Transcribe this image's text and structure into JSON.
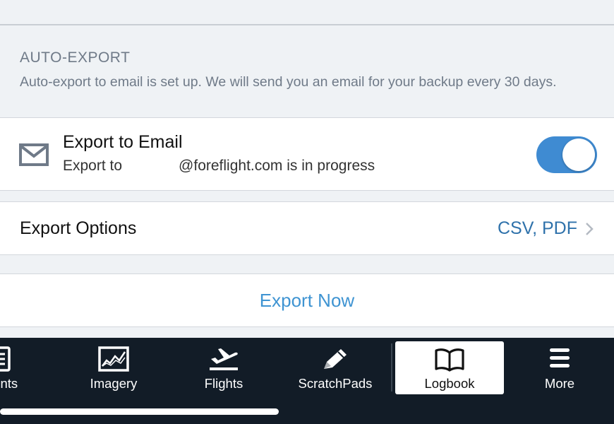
{
  "section": {
    "header": "AUTO-EXPORT",
    "description": "Auto-export to email is set up. We will send you an email for your backup every 30 days."
  },
  "export_email": {
    "title": "Export to Email",
    "subtitle_prefix": "Export to",
    "subtitle_suffix": "@foreflight.com is in progress",
    "toggle_on": true
  },
  "export_options": {
    "label": "Export Options",
    "value": "CSV, PDF"
  },
  "export_now": {
    "label": "Export Now"
  },
  "tabbar": {
    "tabs": [
      {
        "label": "ments",
        "icon": "documents-icon"
      },
      {
        "label": "Imagery",
        "icon": "imagery-icon"
      },
      {
        "label": "Flights",
        "icon": "airplane-departure-icon"
      },
      {
        "label": "ScratchPads",
        "icon": "pencil-icon"
      },
      {
        "label": "Logbook",
        "icon": "open-book-icon",
        "selected": true
      },
      {
        "label": "More",
        "icon": "menu-icon"
      }
    ]
  },
  "colors": {
    "accent_blue": "#3f8bd2",
    "link_blue": "#3f94d2",
    "value_blue": "#2f72ab",
    "tabbar_bg": "#121c27",
    "group_bg": "#eff2f5"
  }
}
